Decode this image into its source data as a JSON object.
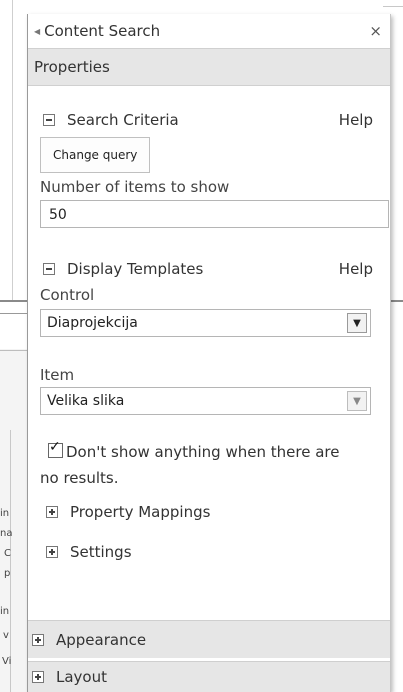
{
  "panel": {
    "title": "Content Search",
    "close_glyph": "×",
    "section_title": "Properties"
  },
  "search_criteria": {
    "label": "Search Criteria",
    "help": "Help",
    "change_query_label": "Change query",
    "items_label": "Number of items to show",
    "items_value": "50"
  },
  "display_templates": {
    "label": "Display Templates",
    "help": "Help",
    "control_label": "Control",
    "control_value": "Diaprojekcija",
    "item_label": "Item",
    "item_value": "Velika slika"
  },
  "options": {
    "no_results_label": "Don't show anything when there are no results.",
    "no_results_checked": true
  },
  "sub_sections": {
    "property_mappings": "Property Mappings",
    "settings": "Settings"
  },
  "footer_sections": {
    "appearance": "Appearance",
    "layout": "Layout"
  },
  "icons": {
    "collapse": "minus-box-icon",
    "expand": "plus-box-icon",
    "dropdown": "chevron-down-icon",
    "panel_back": "triangle-left-icon"
  },
  "background_fragments": [
    "in",
    "na",
    "C",
    "p",
    "in",
    "v",
    "Vi"
  ]
}
